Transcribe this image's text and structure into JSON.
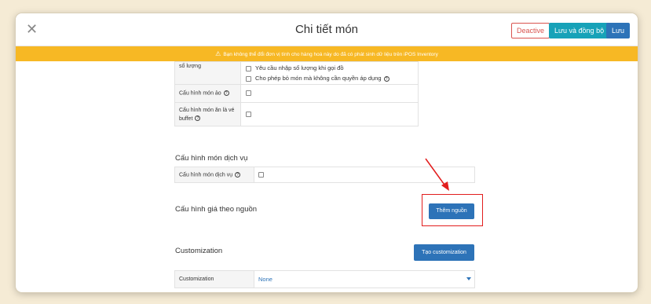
{
  "header": {
    "title": "Chi tiết món",
    "close_icon": "close-icon",
    "deactive_label": "Deactive",
    "sync_label": "Lưu và đồng bộ",
    "save_label": "Lưu"
  },
  "banner": {
    "icon": "warning-icon",
    "text": "Bạn không thể đổi đơn vị tính cho hàng hoá này do đã có phát sinh dữ liệu trên iPOS Inventory"
  },
  "quantity_row": {
    "label": "số lượng",
    "options": [
      {
        "label": "Yêu cầu nhập số lượng khi gọi đồ",
        "checked": false,
        "help": false
      },
      {
        "label": "Cho phép bỏ món mà không cần quyền áp dụng",
        "checked": false,
        "help": true
      }
    ]
  },
  "virtual_item_row": {
    "label": "Cấu hình món ảo",
    "checked": false
  },
  "buffet_row": {
    "label_line1": "Cấu hình món ăn là vé",
    "label_line2": "buffet",
    "checked": false
  },
  "service_section": {
    "title": "Cấu hình món dịch vụ",
    "row_label": "Cấu hình món dịch vụ",
    "checked": false
  },
  "source_price_section": {
    "title": "Cấu hình giá theo nguồn",
    "add_button_label": "Thêm nguồn"
  },
  "customization_section": {
    "title": "Customization",
    "create_button_label": "Tạo customization",
    "row_label": "Customization",
    "selected_value": "None"
  },
  "annotation": {
    "color": "#e21d1d"
  },
  "colors": {
    "primary": "#2d73b8",
    "teal": "#17a2b8",
    "danger": "#d9534f",
    "warning": "#f7b824",
    "page_background": "#f5ebd5"
  }
}
